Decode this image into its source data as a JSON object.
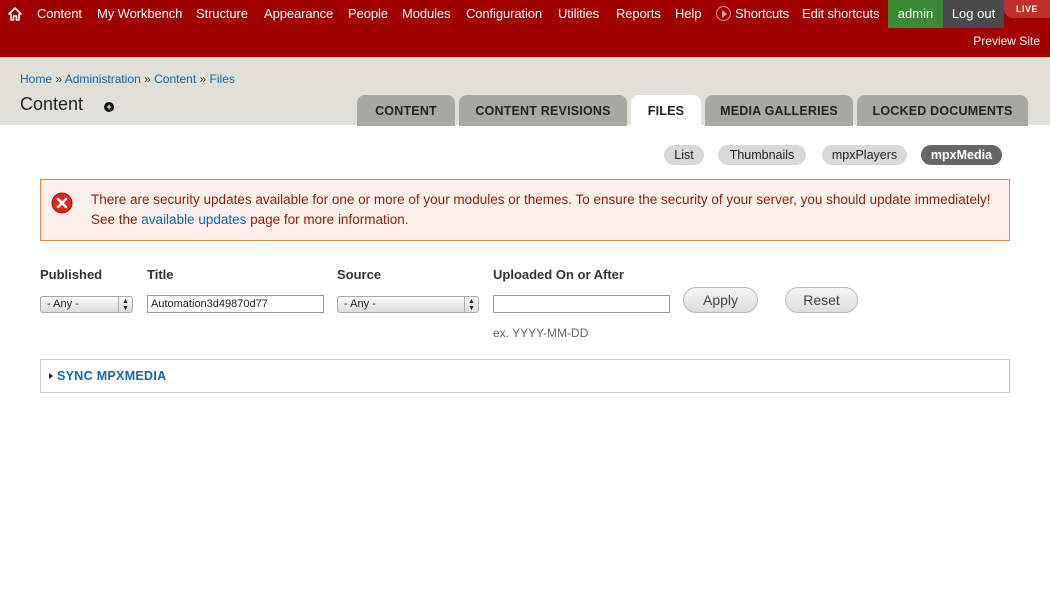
{
  "toolbar": {
    "menu": [
      {
        "label": "Content"
      },
      {
        "label": "My Workbench"
      },
      {
        "label": "Structure"
      },
      {
        "label": "Appearance"
      },
      {
        "label": "People"
      },
      {
        "label": "Modules"
      },
      {
        "label": "Configuration"
      },
      {
        "label": "Utilities"
      },
      {
        "label": "Reports"
      },
      {
        "label": "Help"
      }
    ],
    "shortcuts_label": "Shortcuts",
    "edit_shortcuts_label": "Edit shortcuts",
    "user_label": "admin",
    "logout_label": "Log out",
    "env_badge": "LIVE",
    "preview_site_label": "Preview Site",
    "colors": {
      "bar": "#a10000",
      "user": "#3c8a36",
      "logout": "#4a4a4a",
      "badge": "#c0302a"
    }
  },
  "breadcrumb": {
    "items": [
      "Home",
      "Administration",
      "Content",
      "Files"
    ],
    "separator": "»"
  },
  "page_title": "Content",
  "add_shortcut_symbol": "+",
  "primary_tabs": [
    {
      "label": "CONTENT",
      "active": false
    },
    {
      "label": "CONTENT REVISIONS",
      "active": false
    },
    {
      "label": "FILES",
      "active": true
    },
    {
      "label": "MEDIA GALLERIES",
      "active": false
    },
    {
      "label": "LOCKED DOCUMENTS",
      "active": false
    }
  ],
  "secondary_tabs": [
    {
      "label": "List",
      "active": false
    },
    {
      "label": "Thumbnails",
      "active": false
    },
    {
      "label": "mpxPlayers",
      "active": false
    },
    {
      "label": "mpxMedia",
      "active": true
    }
  ],
  "message": {
    "type": "error",
    "text_before": "There are security updates available for one or more of your modules or themes. To ensure the security of your server, you should update immediately! See the ",
    "link_text": "available updates",
    "text_after": " page for more information."
  },
  "filters": {
    "published": {
      "label": "Published",
      "value": "- Any -"
    },
    "title": {
      "label": "Title",
      "value": "Automation3d49870d77"
    },
    "source": {
      "label": "Source",
      "value": "- Any -"
    },
    "uploaded": {
      "label": "Uploaded On or After",
      "value": "",
      "hint": "ex. YYYY-MM-DD"
    },
    "apply_label": "Apply",
    "reset_label": "Reset"
  },
  "fieldset": {
    "legend": "SYNC MPXMEDIA"
  }
}
